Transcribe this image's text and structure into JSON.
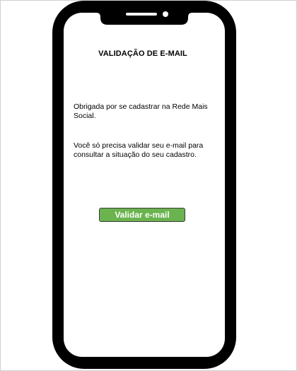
{
  "screen": {
    "title": "VALIDAÇÃO DE E-MAIL",
    "paragraph_1": "Obrigada por se cadastrar na Rede Mais Social.",
    "paragraph_2": "Você só precisa validar seu e-mail para consultar a situação do seu cadastro.",
    "validate_button_label": "Validar e-mail"
  },
  "colors": {
    "button_background": "#6ab34e",
    "button_text": "#ffffff",
    "phone_frame": "#000000",
    "screen_background": "#ffffff"
  },
  "icons": {
    "speaker": "speaker-slot-icon",
    "camera": "front-camera-icon"
  }
}
